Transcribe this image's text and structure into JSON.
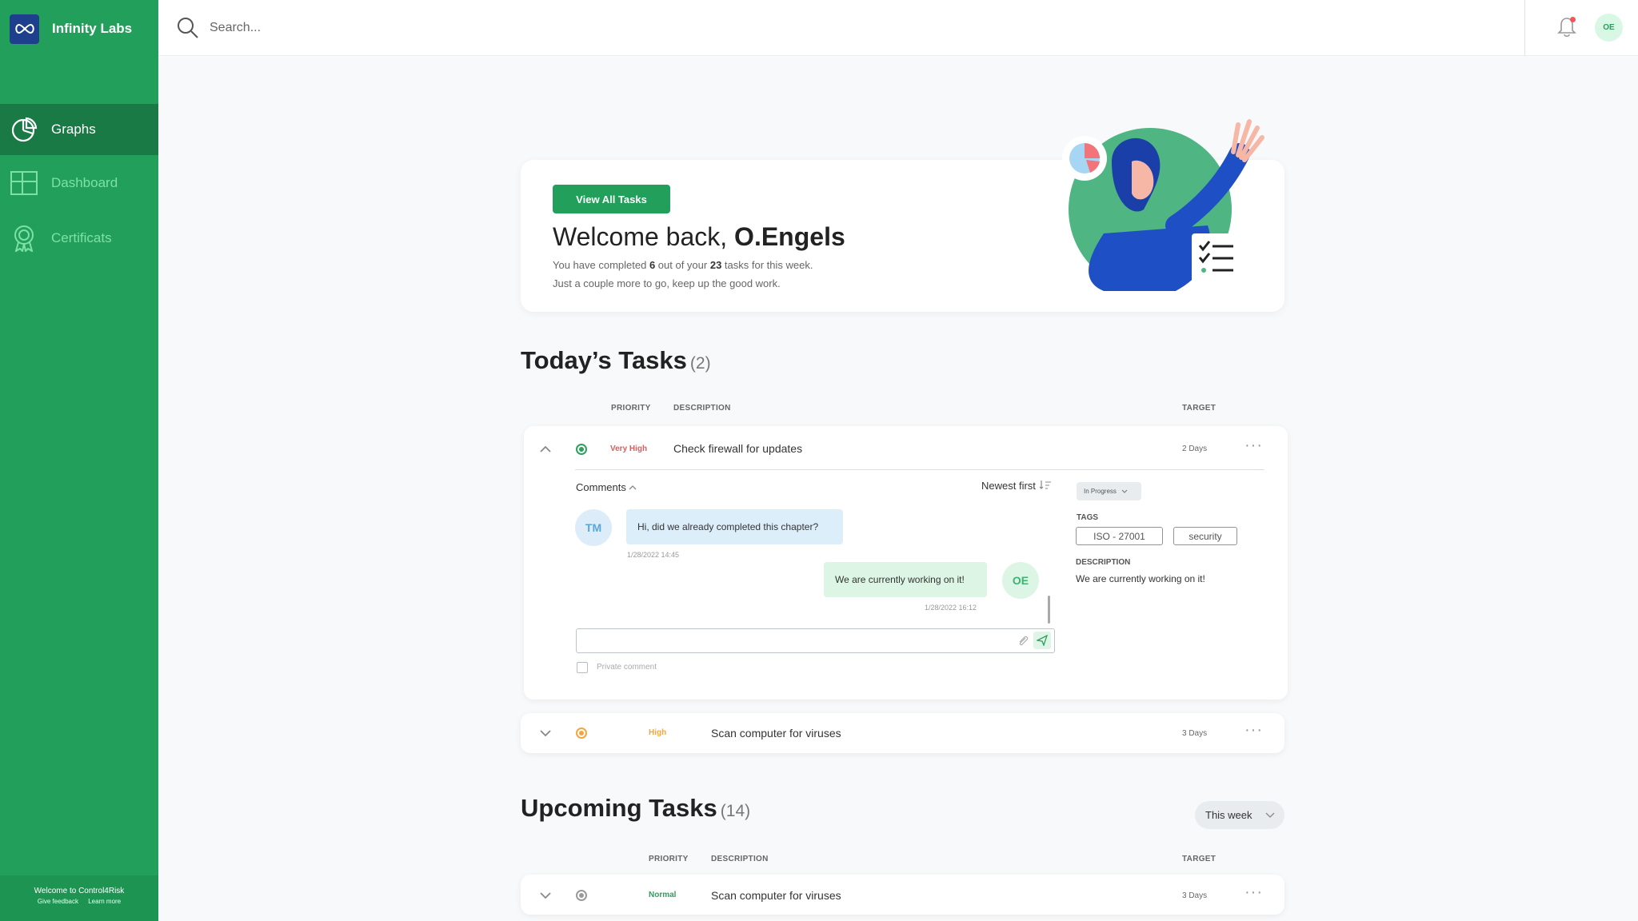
{
  "brand": {
    "name": "Infinity Labs"
  },
  "nav": [
    {
      "label": "Graphs"
    },
    {
      "label": "Dashboard"
    },
    {
      "label": "Certificats"
    }
  ],
  "footer": {
    "welcome": "Welcome to Control4Risk",
    "feedback": "Give feedback",
    "learn": "Learn more"
  },
  "topbar": {
    "search_placeholder": "Search...",
    "avatar_initials": "OE"
  },
  "welcome": {
    "button": "View All Tasks",
    "greeting": "Welcome back, ",
    "name": "O.Engels",
    "line1_a": "You have completed ",
    "completed": "6",
    "line1_b": " out of your ",
    "total": "23",
    "line1_c": " tasks for this week.",
    "line2": "Just a couple more to go, keep up the good work."
  },
  "today": {
    "title": "Today’s Tasks",
    "count": "(2)",
    "columns": {
      "priority": "PRIORITY",
      "description": "DESCRIPTION",
      "target": "TARGET"
    },
    "tasks": [
      {
        "priority": "Very High",
        "description": "Check firewall for updates",
        "target": "2 Days"
      },
      {
        "priority": "High",
        "description": "Scan computer for viruses",
        "target": "3 Days"
      }
    ],
    "expanded": {
      "comments_label": "Comments",
      "sort_label": "Newest first",
      "comments": [
        {
          "initials": "TM",
          "text": "Hi, did we already completed this chapter?",
          "time": "1/28/2022 14:45"
        },
        {
          "initials": "OE",
          "text": "We are currently working on it!",
          "time": "1/28/2022 16:12"
        }
      ],
      "comment_placeholder": "",
      "private_label": "Private comment",
      "status": "In Progress",
      "tags_label": "TAGS",
      "tags": [
        "ISO - 27001",
        "security"
      ],
      "description_label": "DESCRIPTION",
      "description": "We are currently working on it!"
    }
  },
  "upcoming": {
    "title": "Upcoming Tasks",
    "count": "(14)",
    "filter": "This week",
    "columns": {
      "priority": "PRIORITY",
      "description": "DESCRIPTION",
      "target": "TARGET"
    },
    "tasks": [
      {
        "priority": "Normal",
        "description": "Scan computer for viruses",
        "target": "3 Days"
      }
    ]
  },
  "colors": {
    "sidebar": "#22a05b",
    "sidebar_active": "#1a7a45",
    "very_high": "#e05b5b",
    "high": "#f2a640",
    "normal": "#2ea05c",
    "accent": "#22a05b"
  }
}
